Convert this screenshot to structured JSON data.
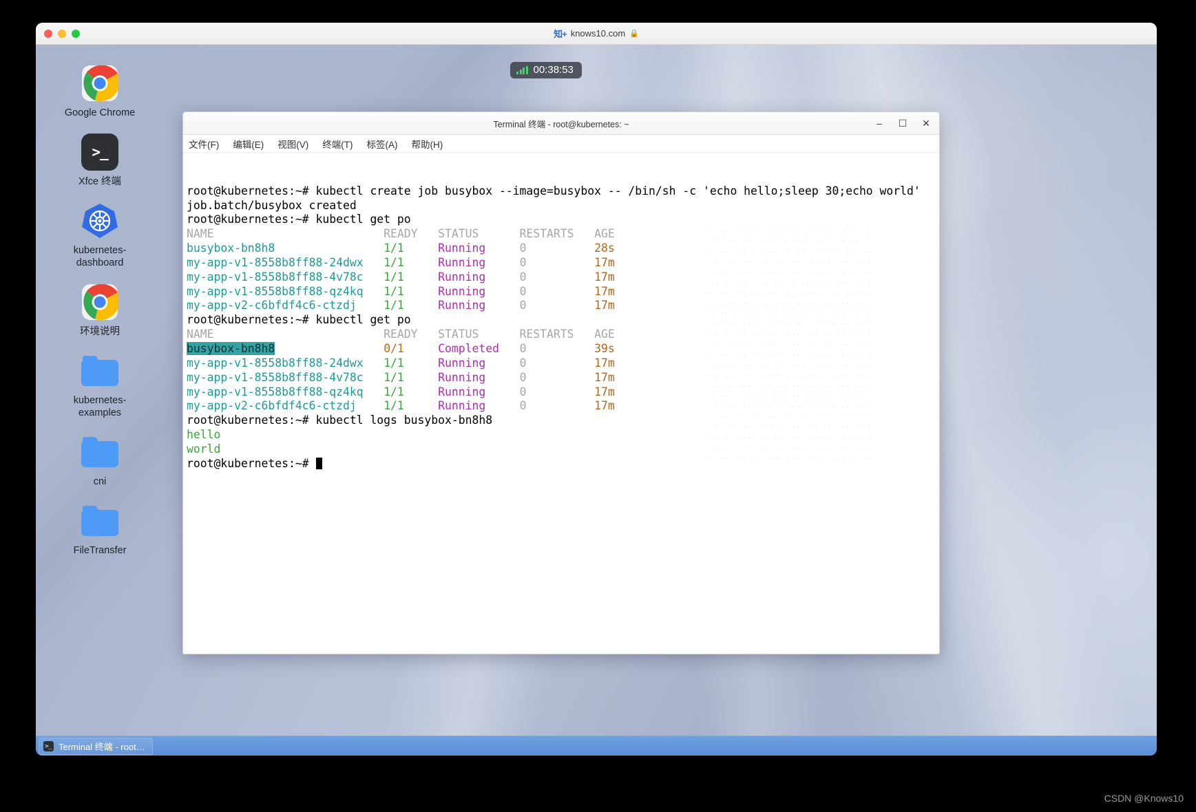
{
  "browser": {
    "title": "knows10.com",
    "site_logo": "知+",
    "lock_icon": "lock-icon",
    "traffic_lights": [
      "close",
      "minimize",
      "zoom"
    ]
  },
  "time_overlay": {
    "signal_icon": "signal-bars-icon",
    "time": "00:38:53"
  },
  "desktop": {
    "icons": [
      {
        "label": "Google Chrome",
        "icon": "chrome-icon"
      },
      {
        "label": "Xfce 终端",
        "icon": "terminal-icon"
      },
      {
        "label": "kubernetes-dashboard",
        "icon": "kubernetes-icon"
      },
      {
        "label": "环境说明",
        "icon": "chrome-icon"
      },
      {
        "label": "kubernetes-examples",
        "icon": "folder-icon"
      },
      {
        "label": "cni",
        "icon": "folder-icon"
      },
      {
        "label": "FileTransfer",
        "icon": "folder-icon"
      }
    ]
  },
  "taskbar": {
    "item_label": "Terminal 终端 - root…",
    "item_icon": "terminal-icon"
  },
  "terminal": {
    "title": "Terminal 终端 - root@kubernetes: ~",
    "window_buttons": {
      "minimize": "–",
      "maximize": "☐",
      "close": "✕"
    },
    "menu": [
      "文件(F)",
      "编辑(E)",
      "视图(V)",
      "终端(T)",
      "标签(A)",
      "帮助(H)"
    ],
    "prompt": "root@kubernetes:~#",
    "commands": {
      "create_job": "kubectl create job busybox --image=busybox -- /bin/sh -c 'echo hello;sleep 30;echo world'",
      "create_job_result": "job.batch/busybox created",
      "get_po": "kubectl get po",
      "logs": "kubectl logs busybox-bn8h8"
    },
    "table_headers": [
      "NAME",
      "READY",
      "STATUS",
      "RESTARTS",
      "AGE"
    ],
    "table1": [
      {
        "name": "busybox-bn8h8",
        "ready": "1/1",
        "status": "Running",
        "restarts": "0",
        "age": "28s",
        "selected": false,
        "ready_ok": true
      },
      {
        "name": "my-app-v1-8558b8ff88-24dwx",
        "ready": "1/1",
        "status": "Running",
        "restarts": "0",
        "age": "17m",
        "selected": false,
        "ready_ok": true
      },
      {
        "name": "my-app-v1-8558b8ff88-4v78c",
        "ready": "1/1",
        "status": "Running",
        "restarts": "0",
        "age": "17m",
        "selected": false,
        "ready_ok": true
      },
      {
        "name": "my-app-v1-8558b8ff88-qz4kq",
        "ready": "1/1",
        "status": "Running",
        "restarts": "0",
        "age": "17m",
        "selected": false,
        "ready_ok": true
      },
      {
        "name": "my-app-v2-c6bfdf4c6-ctzdj",
        "ready": "1/1",
        "status": "Running",
        "restarts": "0",
        "age": "17m",
        "selected": false,
        "ready_ok": true
      }
    ],
    "table2": [
      {
        "name": "busybox-bn8h8",
        "ready": "0/1",
        "status": "Completed",
        "restarts": "0",
        "age": "39s",
        "selected": true,
        "ready_ok": false
      },
      {
        "name": "my-app-v1-8558b8ff88-24dwx",
        "ready": "1/1",
        "status": "Running",
        "restarts": "0",
        "age": "17m",
        "selected": false,
        "ready_ok": true
      },
      {
        "name": "my-app-v1-8558b8ff88-4v78c",
        "ready": "1/1",
        "status": "Running",
        "restarts": "0",
        "age": "17m",
        "selected": false,
        "ready_ok": true
      },
      {
        "name": "my-app-v1-8558b8ff88-qz4kq",
        "ready": "1/1",
        "status": "Running",
        "restarts": "0",
        "age": "17m",
        "selected": false,
        "ready_ok": true
      },
      {
        "name": "my-app-v2-c6bfdf4c6-ctzdj",
        "ready": "1/1",
        "status": "Running",
        "restarts": "0",
        "age": "17m",
        "selected": false,
        "ready_ok": true
      }
    ],
    "log_output": [
      "hello",
      "world"
    ]
  },
  "watermark": "CSDN @Knows10",
  "colors": {
    "pod_name": "#1b9a9a",
    "ready_ok": "#3aa33a",
    "ready_notok": "#c46a10",
    "status": "#b32bb3",
    "age": "#b5651d",
    "header": "#a6a6a6",
    "selection_bg": "#35a3a3",
    "taskbar": "#5a8ed4"
  }
}
